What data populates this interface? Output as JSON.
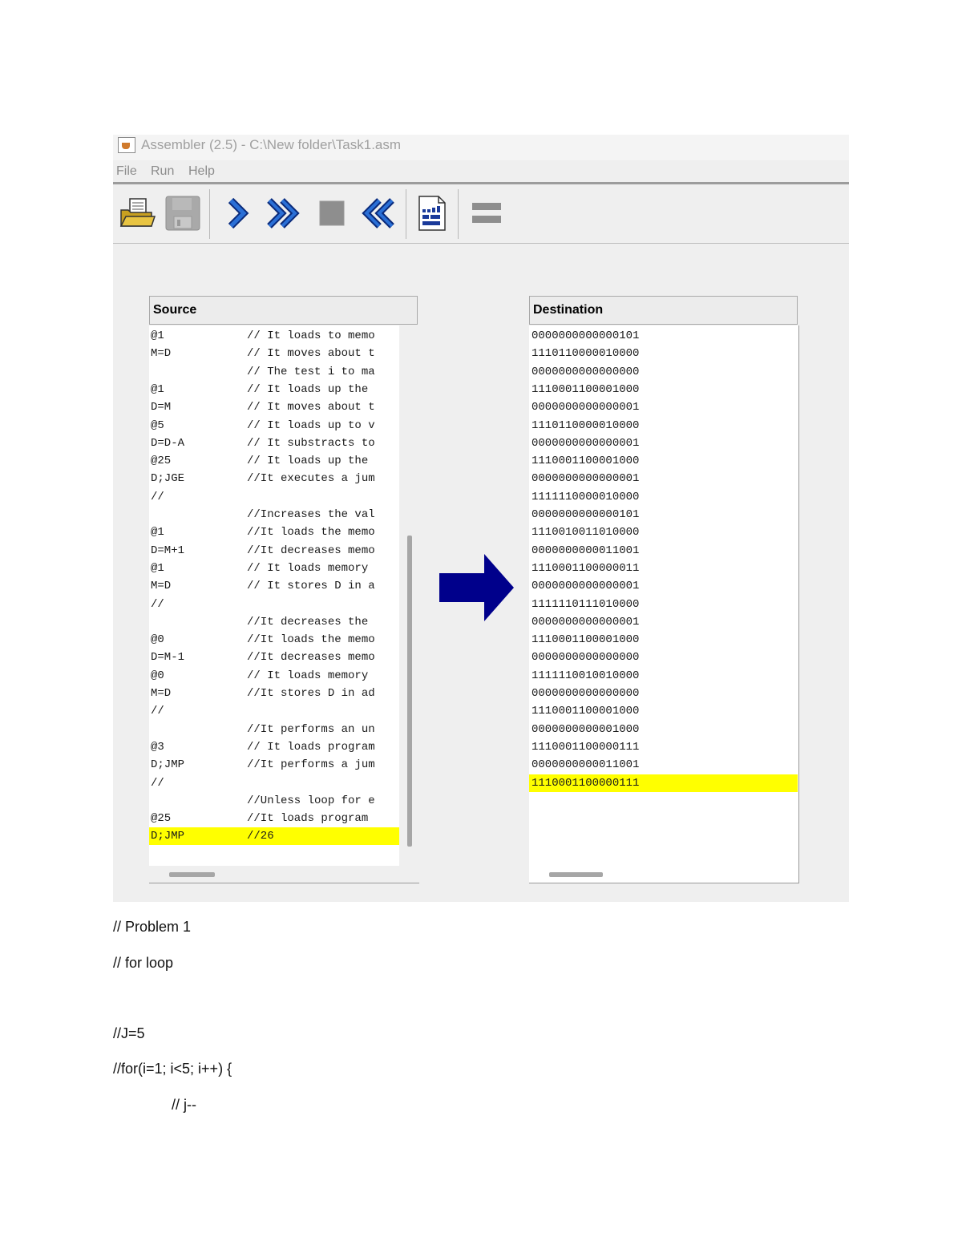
{
  "window": {
    "title": "Assembler (2.5) - C:\\New folder\\Task1.asm",
    "menu": [
      "File",
      "Run",
      "Help"
    ],
    "toolbar": [
      "load-file",
      "save",
      "single-step",
      "fast-forward",
      "stop",
      "rewind",
      "compare-file",
      "translation-mode"
    ]
  },
  "source": {
    "header": "Source",
    "lines": [
      {
        "code": "@1",
        "comment": "// It loads to memo"
      },
      {
        "code": "M=D",
        "comment": "// It moves about t"
      },
      {
        "code": "",
        "comment": "// The test i to ma"
      },
      {
        "code": "@1",
        "comment": "// It loads up the"
      },
      {
        "code": "D=M",
        "comment": "// It moves about t"
      },
      {
        "code": "@5",
        "comment": "// It loads up to v"
      },
      {
        "code": "D=D-A",
        "comment": "// It substracts to"
      },
      {
        "code": "@25",
        "comment": "// It loads up the"
      },
      {
        "code": "D;JGE",
        "comment": "//It executes a jum"
      },
      {
        "code": "//",
        "comment": ""
      },
      {
        "code": "",
        "comment": "//Increases the val"
      },
      {
        "code": "@1",
        "comment": "//It loads the memo"
      },
      {
        "code": "D=M+1",
        "comment": "//It decreases memo"
      },
      {
        "code": "@1",
        "comment": "// It loads memory"
      },
      {
        "code": "M=D",
        "comment": "// It stores D in a"
      },
      {
        "code": "//",
        "comment": ""
      },
      {
        "code": "",
        "comment": "//It decreases the"
      },
      {
        "code": "@0",
        "comment": "//It loads the memo"
      },
      {
        "code": "D=M-1",
        "comment": "//It decreases memo"
      },
      {
        "code": "@0",
        "comment": "// It loads memory"
      },
      {
        "code": "M=D",
        "comment": "//It stores D in ad"
      },
      {
        "code": "//",
        "comment": ""
      },
      {
        "code": "",
        "comment": "//It performs an un"
      },
      {
        "code": "@3",
        "comment": "// It loads program"
      },
      {
        "code": "D;JMP",
        "comment": "//It performs a jum"
      },
      {
        "code": "//",
        "comment": ""
      },
      {
        "code": "",
        "comment": "//Unless loop for e"
      },
      {
        "code": "@25",
        "comment": "//It loads program"
      },
      {
        "code": "D;JMP",
        "comment": "//26"
      }
    ],
    "highlighted_index": 28
  },
  "destination": {
    "header": "Destination",
    "lines": [
      "0000000000000101",
      "1110110000010000",
      "0000000000000000",
      "1110001100001000",
      "0000000000000001",
      "1110110000010000",
      "0000000000000001",
      "1110001100001000",
      "0000000000000001",
      "1111110000010000",
      "0000000000000101",
      "1110010011010000",
      "0000000000011001",
      "1110001100000011",
      "0000000000000001",
      "1111110111010000",
      "0000000000000001",
      "1110001100001000",
      "0000000000000000",
      "1111110010010000",
      "0000000000000000",
      "1110001100001000",
      "0000000000001000",
      "1110001100000111",
      "0000000000011001",
      "1110001100000111"
    ],
    "highlighted_index": 25
  },
  "colors": {
    "arrow": "#00008b",
    "highlight": "#ffff00"
  },
  "document": {
    "lines": [
      "// Problem 1",
      "// for loop",
      "//J=5",
      "//for(i=1; i<5; i++) {",
      "// j--"
    ]
  }
}
